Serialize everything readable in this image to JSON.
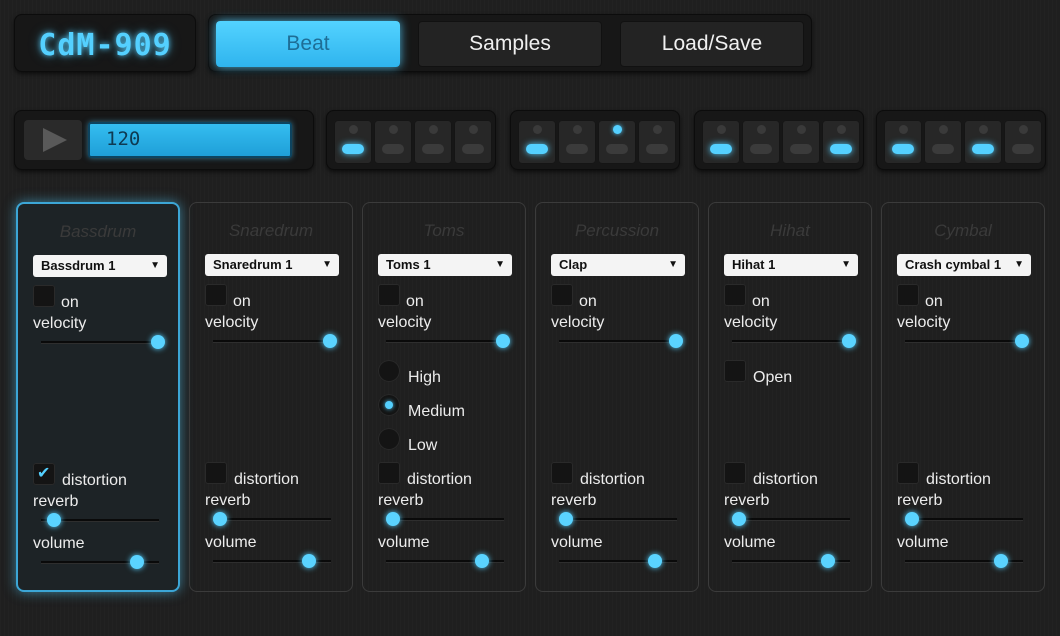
{
  "app": {
    "logo": "CdM-909"
  },
  "nav": {
    "tabs": [
      {
        "label": "Beat",
        "active": true
      },
      {
        "label": "Samples",
        "active": false
      },
      {
        "label": "Load/Save",
        "active": false
      }
    ]
  },
  "transport": {
    "tempo": "120"
  },
  "pattern": {
    "groups": [
      {
        "steps": [
          {
            "on": true,
            "current": false
          },
          {
            "on": false,
            "current": false
          },
          {
            "on": false,
            "current": false
          },
          {
            "on": false,
            "current": false
          }
        ]
      },
      {
        "steps": [
          {
            "on": true,
            "current": false
          },
          {
            "on": false,
            "current": false
          },
          {
            "on": false,
            "current": true
          },
          {
            "on": false,
            "current": false
          }
        ]
      },
      {
        "steps": [
          {
            "on": true,
            "current": false
          },
          {
            "on": false,
            "current": false
          },
          {
            "on": false,
            "current": false
          },
          {
            "on": true,
            "current": false
          }
        ]
      },
      {
        "steps": [
          {
            "on": true,
            "current": false
          },
          {
            "on": false,
            "current": false
          },
          {
            "on": true,
            "current": false
          },
          {
            "on": false,
            "current": false
          }
        ]
      }
    ]
  },
  "labels": {
    "on": "on",
    "velocity": "velocity",
    "distortion": "distortion",
    "reverb": "reverb",
    "volume": "volume"
  },
  "instruments": [
    {
      "title": "Bassdrum",
      "sample": "Bassdrum 1",
      "selected": true,
      "on": false,
      "velocity": 1.0,
      "distortion": true,
      "reverb": 0.1,
      "volume": 0.82
    },
    {
      "title": "Snaredrum",
      "sample": "Snaredrum 1",
      "selected": false,
      "on": false,
      "velocity": 1.0,
      "distortion": false,
      "reverb": 0.05,
      "volume": 0.82
    },
    {
      "title": "Toms",
      "sample": "Toms 1",
      "selected": false,
      "on": false,
      "velocity": 1.0,
      "distortion": false,
      "reverb": 0.05,
      "volume": 0.82,
      "pitch_options": [
        {
          "label": "High",
          "checked": false
        },
        {
          "label": "Medium",
          "checked": true
        },
        {
          "label": "Low",
          "checked": false
        }
      ]
    },
    {
      "title": "Percussion",
      "sample": "Clap",
      "selected": false,
      "on": false,
      "velocity": 1.0,
      "distortion": false,
      "reverb": 0.05,
      "volume": 0.82
    },
    {
      "title": "Hihat",
      "sample": "Hihat 1",
      "selected": false,
      "on": false,
      "velocity": 1.0,
      "distortion": false,
      "reverb": 0.05,
      "volume": 0.82,
      "open_label": "Open",
      "open": false
    },
    {
      "title": "Cymbal",
      "sample": "Crash cymbal 1",
      "selected": false,
      "on": false,
      "velocity": 1.0,
      "distortion": false,
      "reverb": 0.05,
      "volume": 0.82
    }
  ],
  "colors": {
    "accent": "#54d0ff",
    "background": "#1f1f1f",
    "panel": "#171717"
  }
}
